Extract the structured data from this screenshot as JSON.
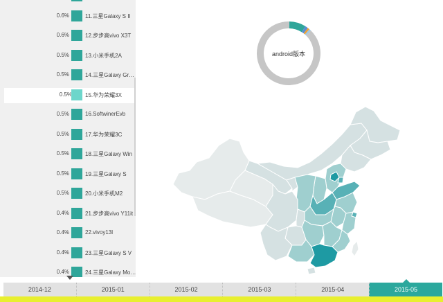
{
  "ranking": {
    "items": [
      {
        "pct": "",
        "label": ""
      },
      {
        "pct": "0.6%",
        "label": "11.三星Galaxy S II"
      },
      {
        "pct": "0.6%",
        "label": "12.步步高vivo X3T"
      },
      {
        "pct": "0.5%",
        "label": "13.小米手机2A"
      },
      {
        "pct": "0.5%",
        "label": "14.三星Galaxy Gr…"
      },
      {
        "pct": "0.5%",
        "label": "15.华为荣耀3X",
        "selected": true
      },
      {
        "pct": "0.5%",
        "label": "16.SoftwinerEvb"
      },
      {
        "pct": "0.5%",
        "label": "17.华为荣耀3C"
      },
      {
        "pct": "0.5%",
        "label": "18.三星Galaxy Win"
      },
      {
        "pct": "0.5%",
        "label": "19.三星Galaxy S"
      },
      {
        "pct": "0.5%",
        "label": "20.小米手机M2"
      },
      {
        "pct": "0.4%",
        "label": "21.步步高vivo Y11it"
      },
      {
        "pct": "0.4%",
        "label": "22.vivoy13l"
      },
      {
        "pct": "0.4%",
        "label": "23.三星Galaxy S V"
      },
      {
        "pct": "0.4%",
        "label": "24.三星Galaxy Mo…"
      }
    ],
    "bar_color": "#2fa69a",
    "selected_color": "#6dd6cb"
  },
  "donut": {
    "label": "android版本",
    "segments": [
      {
        "fraction": 0.88,
        "color": "#c6c6c6"
      },
      {
        "fraction": 0.085,
        "color": "#2fa69a"
      },
      {
        "fraction": 0.015,
        "color": "#5b8ed1"
      },
      {
        "fraction": 0.01,
        "color": "#f0a030"
      },
      {
        "fraction": 0.01,
        "color": "#9ec9e6"
      }
    ]
  },
  "map": {
    "name": "china-map",
    "colors": {
      "base": "#d5e1e2",
      "light": "#e6ebeb",
      "mid": "#9fcfcf",
      "strong": "#58b1b6",
      "max": "#1e9aa3"
    }
  },
  "timeline": {
    "ticks": [
      "2014-12",
      "2015-01",
      "2015-02",
      "2015-03",
      "2015-04",
      "2015-05"
    ],
    "active_index": 5,
    "accent": "#2ba89d",
    "bottom_bar_color": "#e8ef2f"
  }
}
